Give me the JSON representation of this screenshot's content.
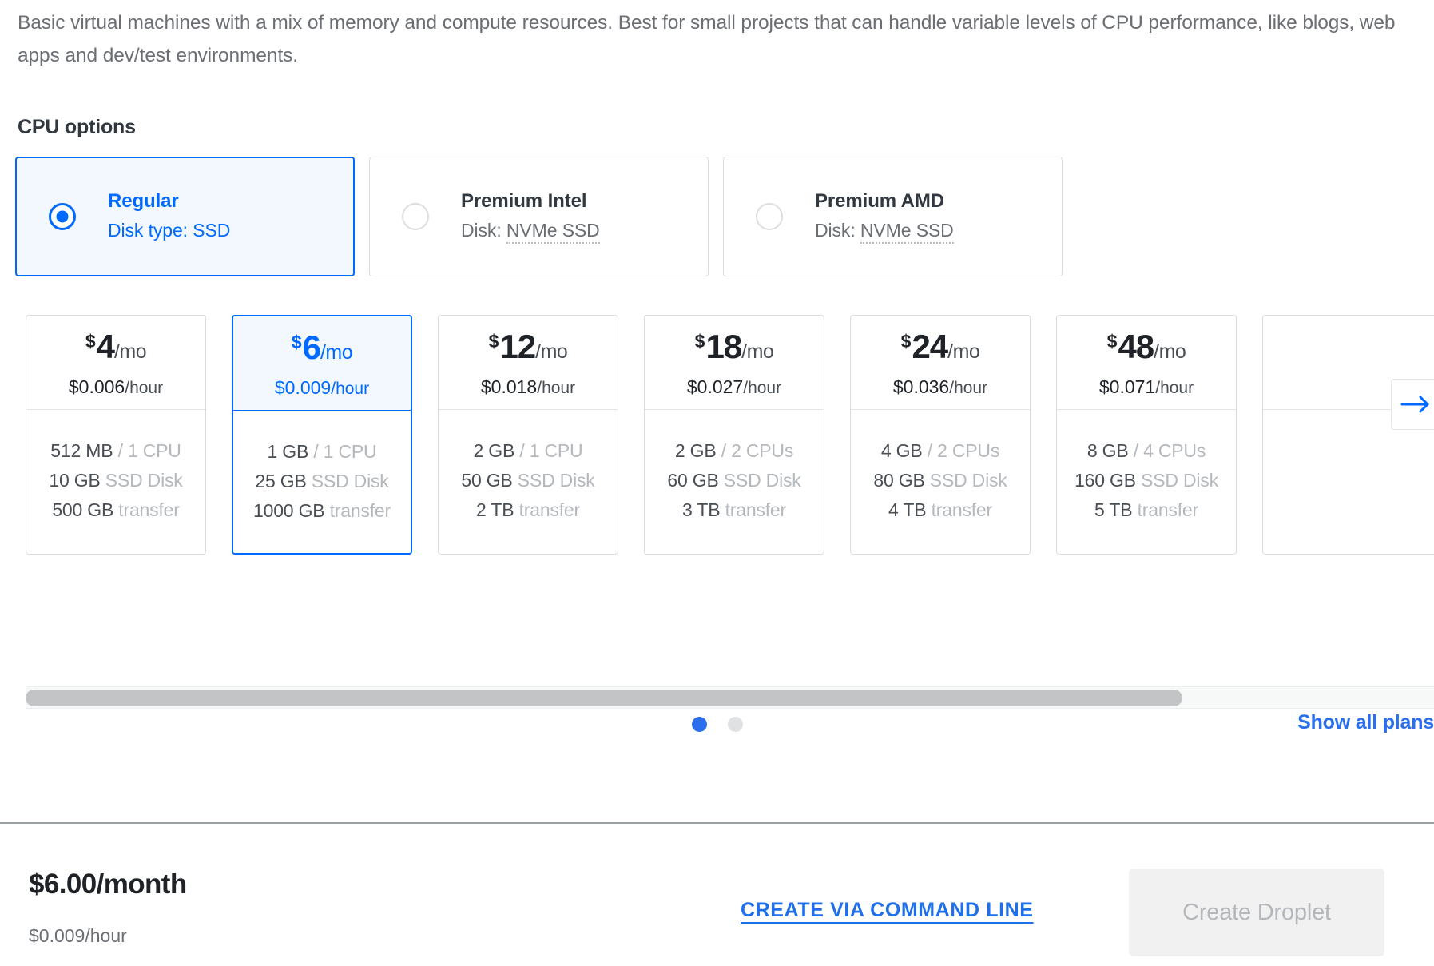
{
  "intro": {
    "description": "Basic virtual machines with a mix of memory and compute resources. Best for small projects that can handle variable levels of CPU performance, like blogs, web apps and dev/test environments."
  },
  "cpu_options": {
    "title": "CPU options",
    "selected": "Regular",
    "items": [
      {
        "name": "Regular",
        "disk_label": "Disk type: ",
        "disk_value": "SSD",
        "selected": true,
        "dotted": false
      },
      {
        "name": "Premium Intel",
        "disk_label": "Disk: ",
        "disk_value": "NVMe SSD",
        "selected": false,
        "dotted": true
      },
      {
        "name": "Premium AMD",
        "disk_label": "Disk: ",
        "disk_value": "NVMe SSD",
        "selected": false,
        "dotted": true
      }
    ]
  },
  "plans": {
    "selected_index": 1,
    "items": [
      {
        "currency": "$",
        "amount": "4",
        "per": "/mo",
        "hourly": "$0.006",
        "hourly_unit": "/hour",
        "memory": "512 MB",
        "cpu": "/ 1 CPU",
        "disk": "10 GB",
        "disk_label": "SSD Disk",
        "transfer": "500 GB",
        "transfer_label": "transfer",
        "selected": false
      },
      {
        "currency": "$",
        "amount": "6",
        "per": "/mo",
        "hourly": "$0.009",
        "hourly_unit": "/hour",
        "memory": "1 GB",
        "cpu": "/ 1 CPU",
        "disk": "25 GB",
        "disk_label": "SSD Disk",
        "transfer": "1000 GB",
        "transfer_label": "transfer",
        "selected": true
      },
      {
        "currency": "$",
        "amount": "12",
        "per": "/mo",
        "hourly": "$0.018",
        "hourly_unit": "/hour",
        "memory": "2 GB",
        "cpu": "/ 1 CPU",
        "disk": "50 GB",
        "disk_label": "SSD Disk",
        "transfer": "2 TB",
        "transfer_label": "transfer",
        "selected": false
      },
      {
        "currency": "$",
        "amount": "18",
        "per": "/mo",
        "hourly": "$0.027",
        "hourly_unit": "/hour",
        "memory": "2 GB",
        "cpu": "/ 2 CPUs",
        "disk": "60 GB",
        "disk_label": "SSD Disk",
        "transfer": "3 TB",
        "transfer_label": "transfer",
        "selected": false
      },
      {
        "currency": "$",
        "amount": "24",
        "per": "/mo",
        "hourly": "$0.036",
        "hourly_unit": "/hour",
        "memory": "4 GB",
        "cpu": "/ 2 CPUs",
        "disk": "80 GB",
        "disk_label": "SSD Disk",
        "transfer": "4 TB",
        "transfer_label": "transfer",
        "selected": false
      },
      {
        "currency": "$",
        "amount": "48",
        "per": "/mo",
        "hourly": "$0.071",
        "hourly_unit": "/hour",
        "memory": "8 GB",
        "cpu": "/ 4 CPUs",
        "disk": "160 GB",
        "disk_label": "SSD Disk",
        "transfer": "5 TB",
        "transfer_label": "transfer",
        "selected": false
      }
    ]
  },
  "carousel": {
    "next_icon": "arrow-right-icon",
    "dots": [
      {
        "active": true
      },
      {
        "active": false
      }
    ],
    "show_all_label": "Show all plans"
  },
  "footer": {
    "total_price": "$6.00/month",
    "total_hourly": "$0.009/hour",
    "cli_link_label": "CREATE VIA COMMAND LINE",
    "create_button_label": "Create Droplet",
    "create_button_disabled": true
  },
  "colors": {
    "accent": "#0069ff",
    "link": "#1f6feb",
    "selected_bg": "#f3f8ff",
    "muted_text": "#b4b8bc",
    "body_text": "#4a4f55"
  }
}
